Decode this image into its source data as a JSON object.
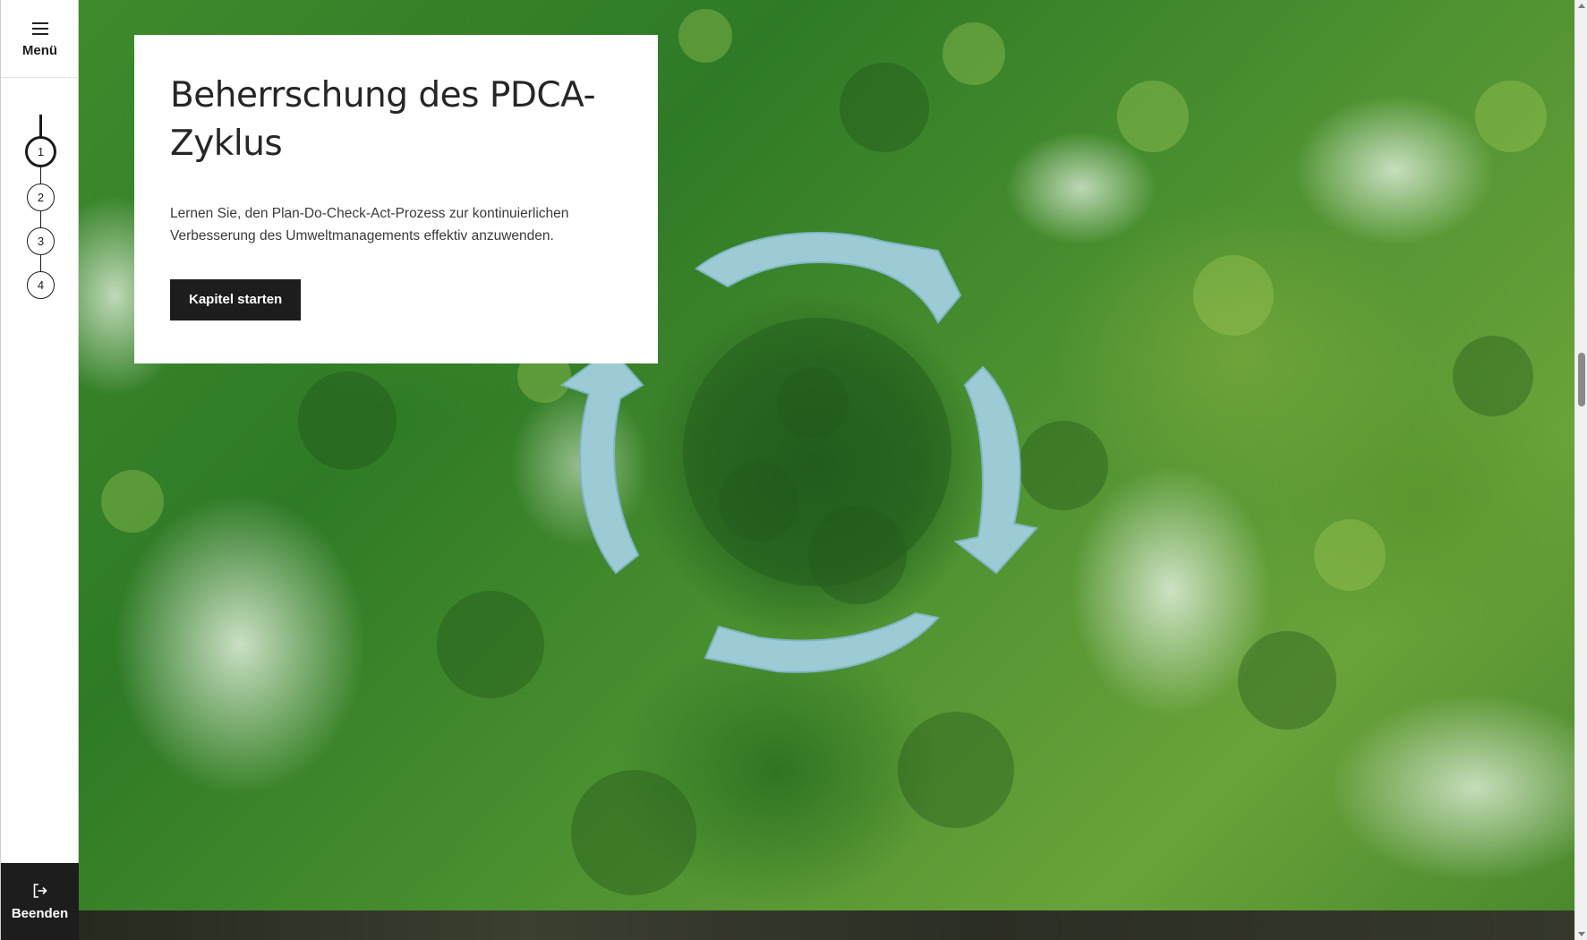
{
  "sidebar": {
    "menu_label": "Menü",
    "menu_icon": "hamburger-icon",
    "steps": [
      {
        "label": "1",
        "active": true
      },
      {
        "label": "2",
        "active": false
      },
      {
        "label": "3",
        "active": false
      },
      {
        "label": "4",
        "active": false
      }
    ],
    "exit_label": "Beenden",
    "exit_icon": "exit-icon"
  },
  "hero": {
    "title": "Beherrschung des PDCA-Zyklus",
    "description": "Lernen Sie, den Plan-Do-Check-Act-Prozess zur kontinuierlichen Verbesserung des Umweltmanagements effektiv anzuwenden.",
    "start_button": "Kapitel starten",
    "image_subject": "forest-aerial-cycle-lake-image"
  },
  "colors": {
    "sidebar_bg": "#ffffff",
    "button_bg": "#1d1d1d",
    "button_text": "#ffffff",
    "card_bg": "#ffffff",
    "text_primary": "#262626"
  }
}
